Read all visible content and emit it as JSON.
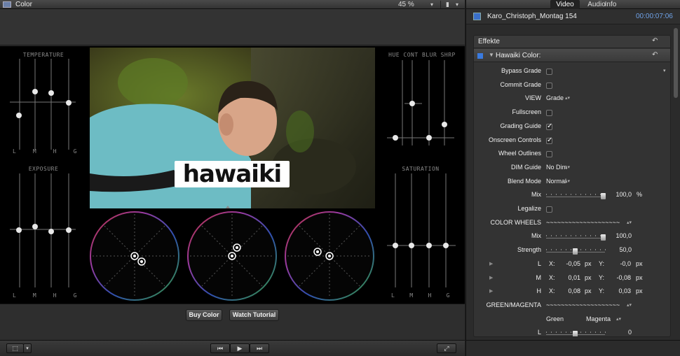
{
  "viewer": {
    "title": "Color",
    "zoom": "45 %",
    "zoom_dropdown": "▾",
    "view_switch": "▮",
    "view_dropdown": "▾",
    "slider_groups": {
      "temperature": {
        "title": "TEMPERATURE",
        "labels": [
          "L",
          "M",
          "H",
          "G"
        ]
      },
      "exposure": {
        "title": "EXPOSURE",
        "labels": [
          "L",
          "M",
          "H",
          "G"
        ]
      },
      "hue": {
        "title": "HUE CONT BLUR SHRP"
      },
      "saturation": {
        "title": "SATURATION",
        "labels": [
          "L",
          "M",
          "H",
          "G"
        ]
      }
    },
    "logo_text": "hawaiki",
    "buy_color": "Buy Color",
    "watch_tutorial": "Watch Tutorial",
    "transport": {
      "prev": "⏮",
      "play": "▶",
      "next": "⏭",
      "view": "⬚",
      "dropdown": "▾",
      "fullscreen": "⤢"
    }
  },
  "inspector": {
    "tabs": [
      "Video",
      "Audio",
      "Info"
    ],
    "active_tab": "Video",
    "clip_name": "Karo_Christoph_Montag 154",
    "timecode": "00:00:07:06",
    "effects_header": "Effekte",
    "effect_name": "Hawaiki Color:",
    "reset_icon": "↶",
    "params": [
      {
        "label": "Bypass Grade",
        "type": "checkbox",
        "checked": false
      },
      {
        "label": "Commit Grade",
        "type": "checkbox",
        "checked": false
      },
      {
        "label": "VIEW",
        "type": "popup",
        "value": "Grade"
      },
      {
        "label": "Fullscreen",
        "type": "checkbox",
        "checked": false
      },
      {
        "label": "Grading Guide",
        "type": "checkbox",
        "checked": true
      },
      {
        "label": "Onscreen Controls",
        "type": "checkbox",
        "checked": true
      },
      {
        "label": "Wheel Outlines",
        "type": "checkbox",
        "checked": false
      },
      {
        "label": "DIM Guide",
        "type": "popup",
        "value": "No Dim"
      },
      {
        "label": "Blend Mode",
        "type": "popup",
        "value": "Normal"
      },
      {
        "label": "Mix",
        "type": "slider",
        "value": "100,0",
        "unit": "%",
        "level": 1.0
      },
      {
        "label": "Legalize",
        "type": "checkbox",
        "checked": false
      },
      {
        "label": "COLOR WHEELS",
        "type": "popup",
        "value": "~~~~~~~~~~~~~~~~~~~~"
      },
      {
        "label": "Mix",
        "type": "slider",
        "value": "100,0",
        "unit": "",
        "level": 1.0
      },
      {
        "label": "Strength",
        "type": "slider",
        "value": "50,0",
        "unit": "",
        "level": 0.5
      },
      {
        "label": "L",
        "type": "xy",
        "x": "-0,05",
        "y": "-0,0",
        "unit": "px"
      },
      {
        "label": "M",
        "type": "xy",
        "x": "0,01",
        "y": "-0,08",
        "unit": "px"
      },
      {
        "label": "H",
        "type": "xy",
        "x": "0,08",
        "y": "0,03",
        "unit": "px"
      },
      {
        "label": "GREEN/MAGENTA",
        "type": "popup",
        "value": "~~~~~~~~~~~~~~~~~~~~"
      },
      {
        "label": "",
        "type": "gm_header",
        "left": "Green",
        "right": "Magenta"
      },
      {
        "label": "L",
        "type": "slider",
        "value": "0",
        "unit": "",
        "level": 0.5
      }
    ],
    "x_label": "X:",
    "y_label": "Y:"
  }
}
